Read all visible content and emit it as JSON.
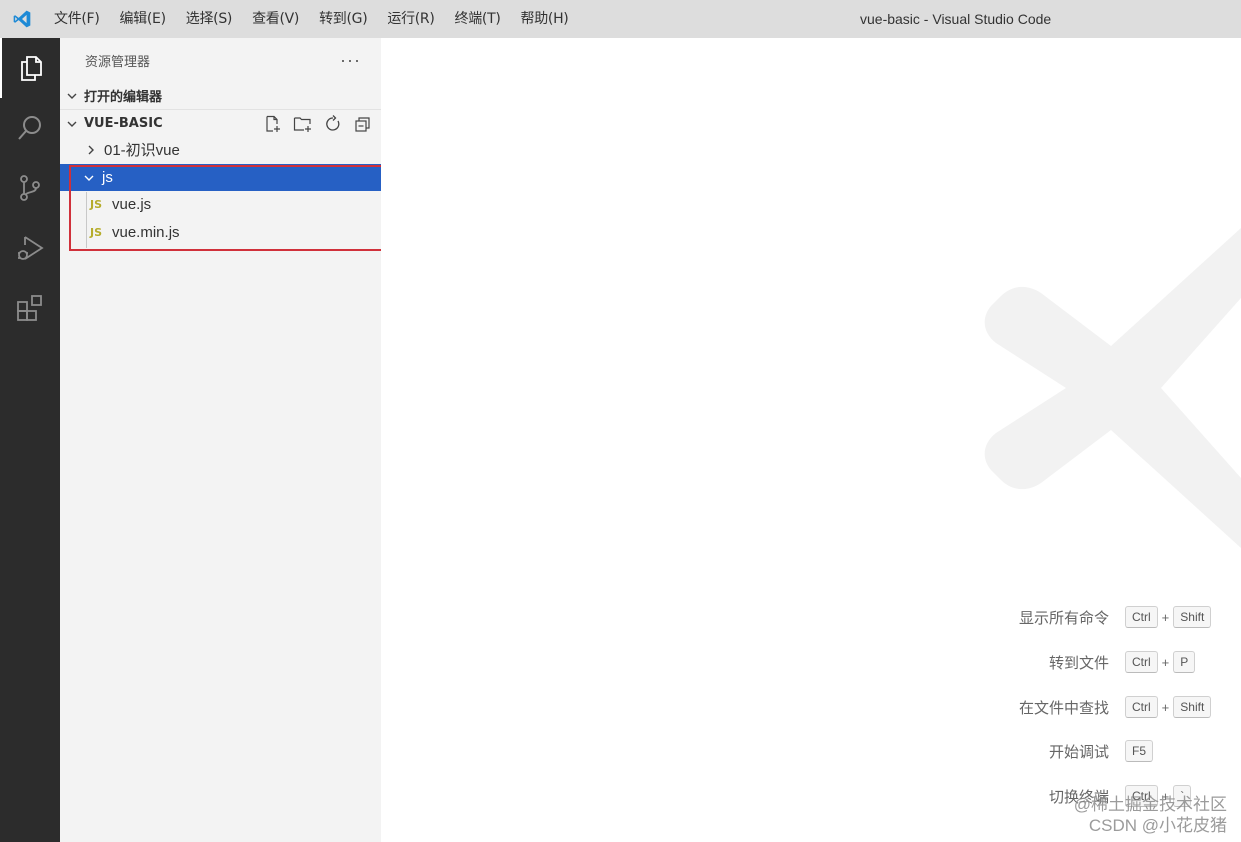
{
  "titlebar": {
    "menus": [
      "文件(F)",
      "编辑(E)",
      "选择(S)",
      "查看(V)",
      "转到(G)",
      "运行(R)",
      "终端(T)",
      "帮助(H)"
    ],
    "window_title": "vue-basic - Visual Studio Code"
  },
  "activitybar": {
    "icons": [
      "explorer-icon",
      "search-icon",
      "source-control-icon",
      "run-debug-icon",
      "extensions-icon"
    ]
  },
  "sidebar": {
    "title": "资源管理器",
    "more": "···",
    "open_editors_label": "打开的编辑器",
    "workspace_label": "VUE-BASIC",
    "tree": [
      {
        "label": "01-初识vue",
        "type": "folder",
        "expanded": false
      },
      {
        "label": "js",
        "type": "folder",
        "expanded": true,
        "selected": true
      },
      {
        "label": "vue.js",
        "type": "file",
        "icon": "JS"
      },
      {
        "label": "vue.min.js",
        "type": "file",
        "icon": "JS"
      }
    ]
  },
  "editor": {
    "shortcuts": [
      {
        "label": "显示所有命令",
        "keys": [
          "Ctrl",
          "Shift"
        ]
      },
      {
        "label": "转到文件",
        "keys": [
          "Ctrl",
          "P"
        ]
      },
      {
        "label": "在文件中查找",
        "keys": [
          "Ctrl",
          "Shift"
        ]
      },
      {
        "label": "开始调试",
        "keys": [
          "F5"
        ]
      },
      {
        "label": "切换终端",
        "keys": [
          "Ctrl",
          "`"
        ]
      }
    ]
  },
  "watermark": {
    "line1": "@稀土掘金技术社区",
    "line2": "CSDN @小花皮猪"
  },
  "colors": {
    "titlebar_bg": "#dddddd",
    "activitybar_bg": "#2c2c2c",
    "sidebar_bg": "#f3f3f3",
    "selection_bg": "#2660c4",
    "highlight_border": "#d0303a",
    "js_icon": "#b5ac2b"
  }
}
